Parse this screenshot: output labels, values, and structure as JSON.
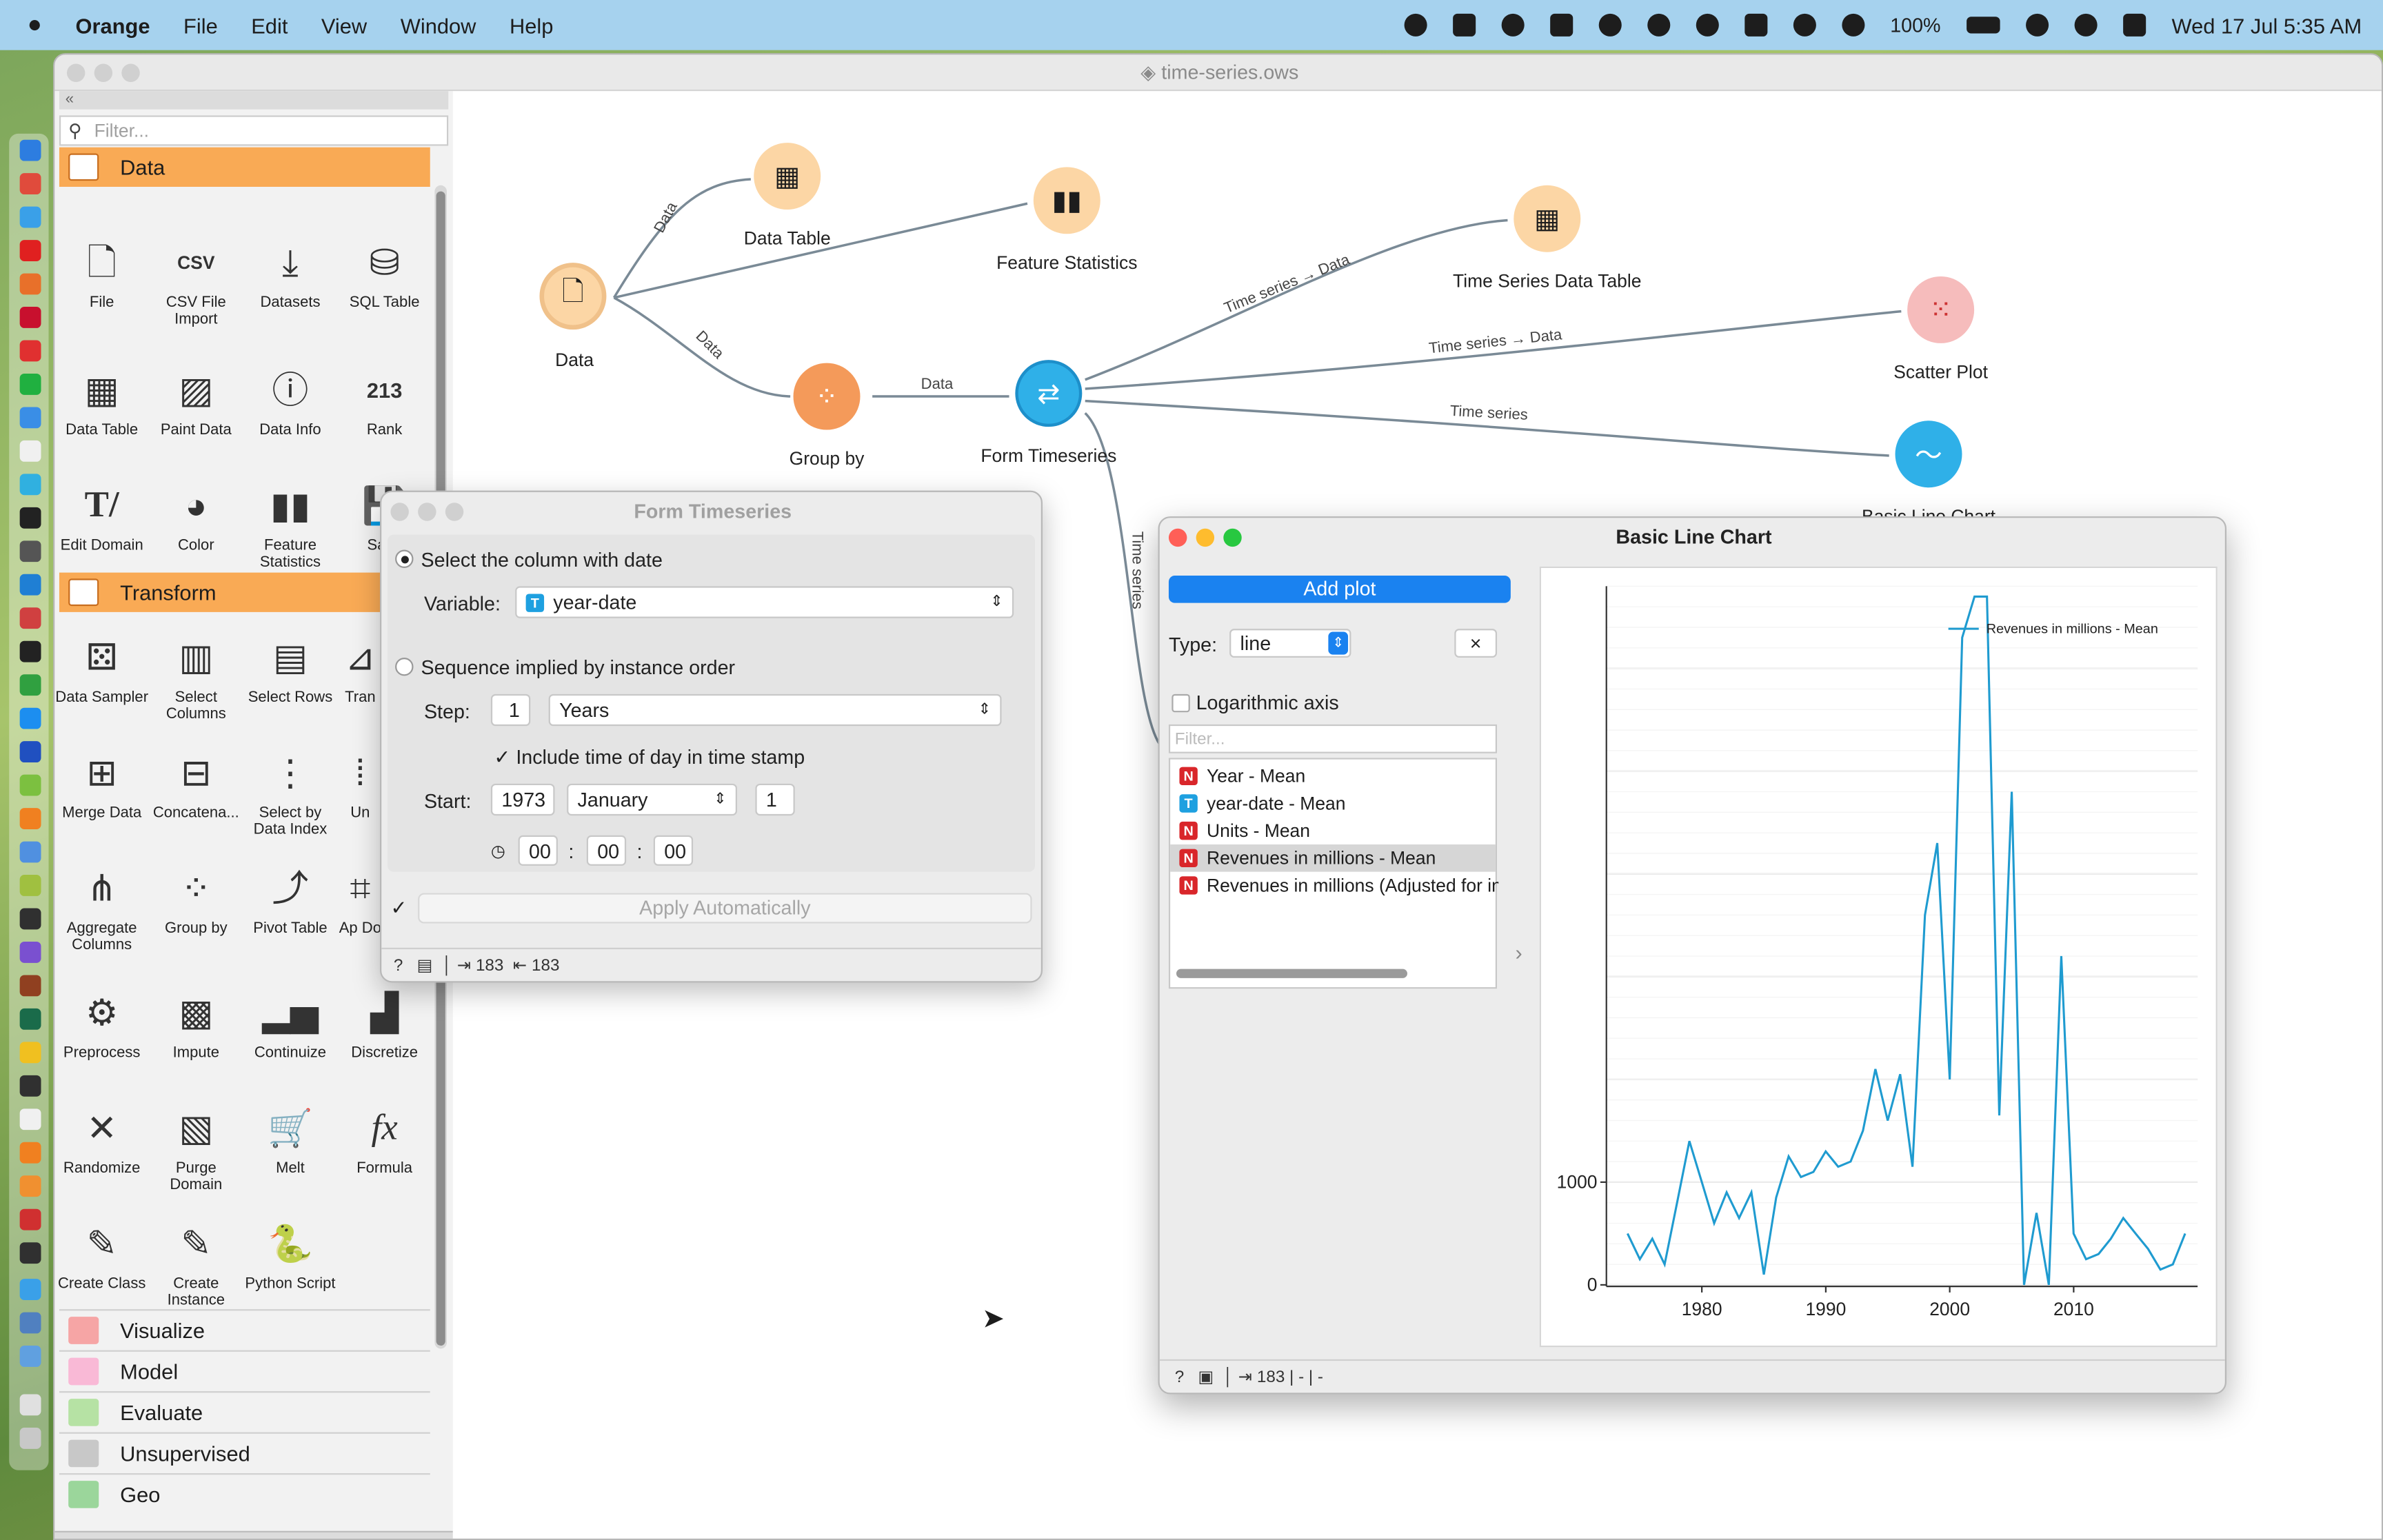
{
  "menubar": {
    "app": "Orange",
    "items": [
      "File",
      "Edit",
      "View",
      "Window",
      "Help"
    ],
    "battery": "100%",
    "datetime": "Wed 17 Jul  5:35 AM"
  },
  "window": {
    "title": "time-series.ows"
  },
  "left_panel": {
    "filter_placeholder": "Filter...",
    "data_category": "Data",
    "transform_category": "Transform",
    "data_widgets": [
      "File",
      "CSV File Import",
      "Datasets",
      "SQL Table",
      "Data Table",
      "Paint Data",
      "Data Info",
      "Rank",
      "Edit Domain",
      "Color",
      "Feature Statistics",
      "Save"
    ],
    "transform_widgets": [
      "Data Sampler",
      "Select Columns",
      "Select Rows",
      "Tran",
      "Merge Data",
      "Concatena...",
      "Select by Data Index",
      "Un",
      "Aggregate Columns",
      "Group by",
      "Pivot Table",
      "Ap Do",
      "Preprocess",
      "Impute",
      "Continuize",
      "Discretize",
      "Randomize",
      "Purge Domain",
      "Melt",
      "Formula",
      "Create Class",
      "Create Instance",
      "Python Script"
    ],
    "other_categories": [
      "Visualize",
      "Model",
      "Evaluate",
      "Unsupervised",
      "Geo"
    ]
  },
  "canvas": {
    "nodes": {
      "data": "Data",
      "data_table": "Data Table",
      "feature_statistics": "Feature Statistics",
      "group_by": "Group by",
      "form_timeseries": "Form Timeseries",
      "ts_data_table": "Time Series Data Table",
      "scatter_plot": "Scatter Plot",
      "basic_line_chart": "Basic Line Chart"
    },
    "edges": {
      "data1": "Data",
      "data2": "Data",
      "data3": "Data",
      "ts_data": "Time series → Data",
      "ts_data2": "Time series → Data",
      "ts": "Time series",
      "ts_vertical": "Time series"
    }
  },
  "form_timeseries": {
    "title": "Form Timeseries",
    "option1": "Select the column with date",
    "variable_label": "Variable:",
    "variable_value": "year-date",
    "option2": "Sequence implied by instance order",
    "step_label": "Step:",
    "step_value": "1",
    "step_unit": "Years",
    "include_time": "Include time of day in time stamp",
    "start_label": "Start:",
    "start_year": "1973",
    "start_month": "January",
    "start_day": "1",
    "hh": "00",
    "mm": "00",
    "ss": "00",
    "apply": "Apply Automatically",
    "status_in": "183",
    "status_out": "183"
  },
  "basic_line_chart": {
    "title": "Basic Line Chart",
    "add_plot": "Add plot",
    "type_label": "Type:",
    "type_value": "line",
    "close": "×",
    "log_axis": "Logarithmic axis",
    "filter_placeholder": "Filter...",
    "variables": [
      {
        "badge": "N",
        "name": "Year - Mean"
      },
      {
        "badge": "T",
        "name": "year-date - Mean"
      },
      {
        "badge": "N",
        "name": "Units - Mean"
      },
      {
        "badge": "N",
        "name": "Revenues in millions - Mean"
      },
      {
        "badge": "N",
        "name": "Revenues in millions (Adjusted for infl"
      }
    ],
    "status": "183 | - | -"
  },
  "chart_data": {
    "type": "line",
    "series": [
      {
        "name": "Revenues in millions - Mean",
        "color": "#1f9bd0"
      }
    ],
    "x": [
      1974,
      1975,
      1976,
      1977,
      1978,
      1979,
      1980,
      1981,
      1982,
      1983,
      1984,
      1985,
      1986,
      1987,
      1988,
      1989,
      1990,
      1991,
      1992,
      1993,
      1994,
      1995,
      1996,
      1997,
      1998,
      1999,
      2000,
      2001,
      2002,
      2003,
      2004,
      2005,
      2006,
      2007,
      2008,
      2009,
      2010,
      2011,
      2012,
      2013,
      2014,
      2015,
      2016,
      2017,
      2018,
      2019
    ],
    "values": [
      500,
      250,
      450,
      200,
      800,
      1400,
      1000,
      600,
      900,
      650,
      900,
      100,
      850,
      1250,
      1050,
      1100,
      1300,
      1150,
      1200,
      1500,
      2100,
      1600,
      2050,
      1150,
      3600,
      4300,
      2000,
      6300,
      6700,
      6700,
      1650,
      4800,
      0,
      700,
      0,
      3200,
      500,
      250,
      300,
      450,
      650,
      500,
      350,
      150,
      200,
      500
    ],
    "xticks": [
      1980,
      1990,
      2000,
      2010
    ],
    "yticks": [
      0,
      1000
    ],
    "ylim": [
      0,
      6800
    ],
    "xlim": [
      1972.3,
      2020
    ],
    "legend_position": "top-right",
    "grid": true
  }
}
